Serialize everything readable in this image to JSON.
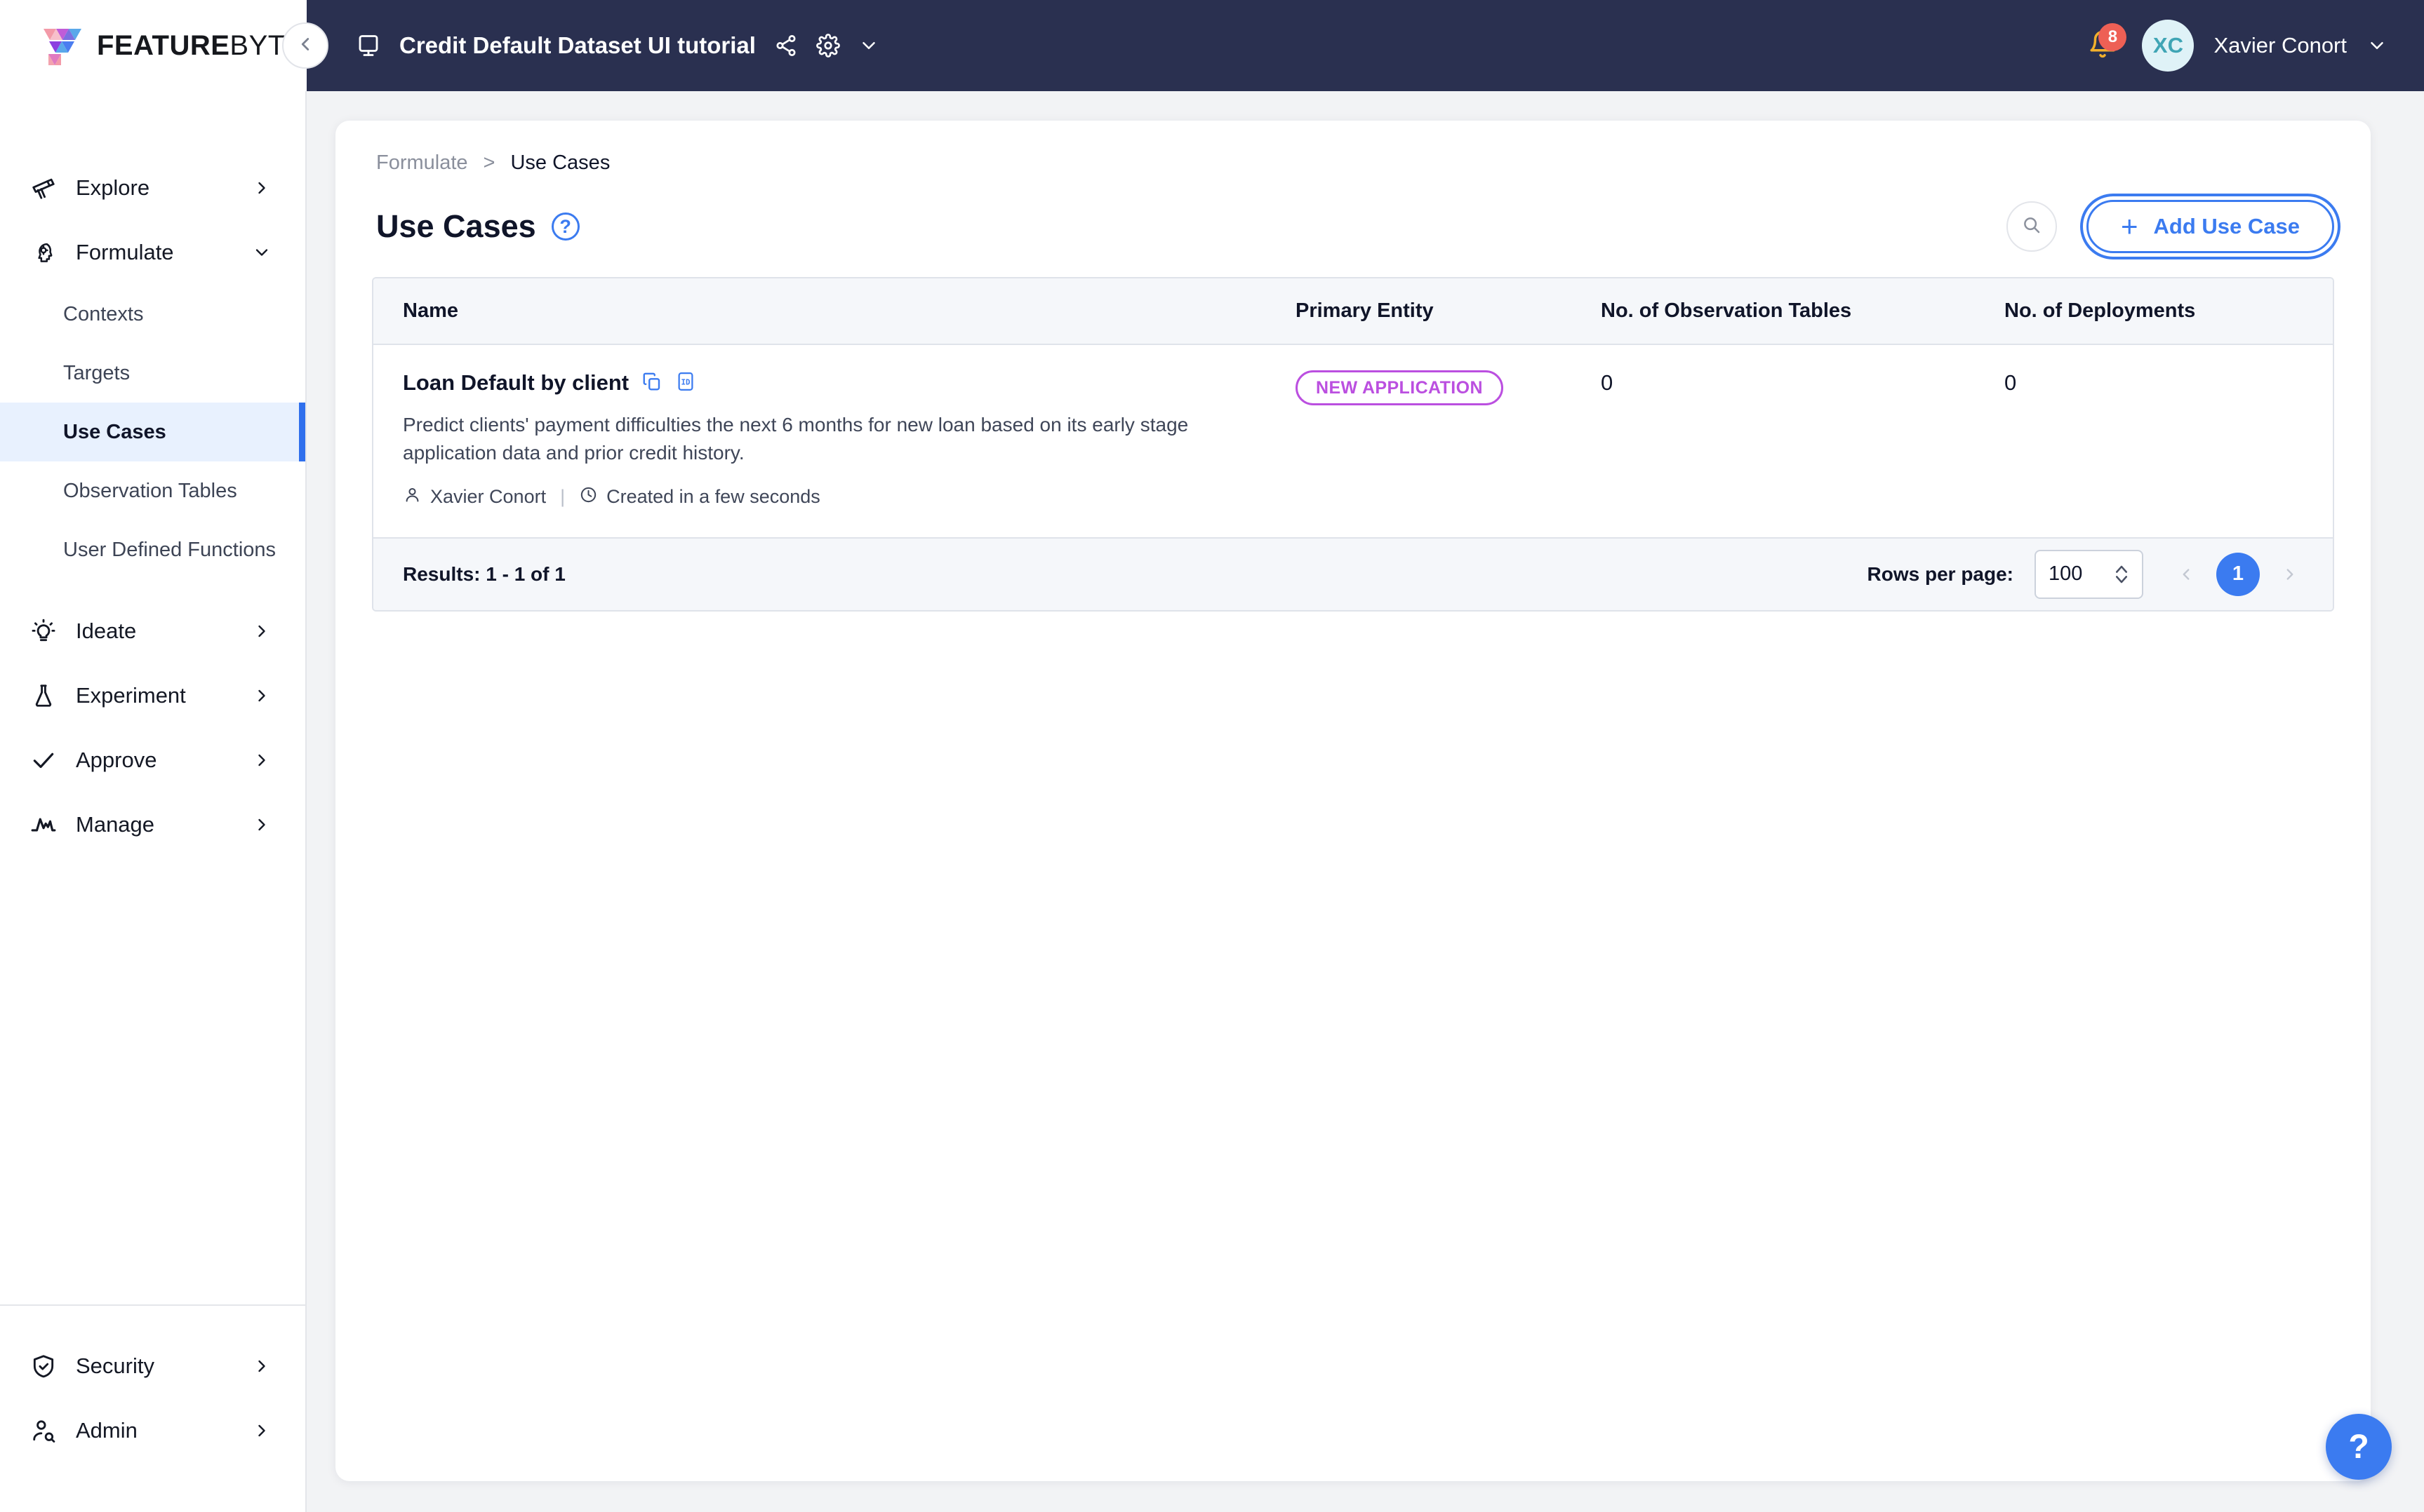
{
  "brand": {
    "name_bold": "FEATURE",
    "name_thin": "BYTE"
  },
  "topbar": {
    "project_title": "Credit Default Dataset UI tutorial",
    "share_icon": "share-icon",
    "settings_icon": "gear-icon",
    "project_chevron_icon": "chevron-down-icon",
    "collapse_icon": "chevron-left-icon",
    "monitor_icon": "monitor-icon",
    "notifications": {
      "icon": "bell-icon",
      "count": "8"
    },
    "user": {
      "initials": "XC",
      "name": "Xavier Conort",
      "chevron_icon": "chevron-down-icon"
    }
  },
  "sidebar": {
    "groups": [
      {
        "label": "Explore",
        "icon": "telescope-icon",
        "chevron": "chevron-right-icon",
        "expanded": false
      },
      {
        "label": "Formulate",
        "icon": "brain-gear-icon",
        "chevron": "chevron-down-icon",
        "expanded": true
      },
      {
        "label": "Ideate",
        "icon": "lightbulb-icon",
        "chevron": "chevron-right-icon",
        "expanded": false
      },
      {
        "label": "Experiment",
        "icon": "flask-icon",
        "chevron": "chevron-right-icon",
        "expanded": false
      },
      {
        "label": "Approve",
        "icon": "check-icon",
        "chevron": "chevron-right-icon",
        "expanded": false
      },
      {
        "label": "Manage",
        "icon": "pulse-icon",
        "chevron": "chevron-right-icon",
        "expanded": false
      }
    ],
    "formulate_children": [
      {
        "label": "Contexts",
        "active": false
      },
      {
        "label": "Targets",
        "active": false
      },
      {
        "label": "Use Cases",
        "active": true
      },
      {
        "label": "Observation Tables",
        "active": false
      },
      {
        "label": "User Defined Functions",
        "active": false
      }
    ],
    "bottom": [
      {
        "label": "Security",
        "icon": "shield-check-icon",
        "chevron": "chevron-right-icon"
      },
      {
        "label": "Admin",
        "icon": "user-search-icon",
        "chevron": "chevron-right-icon"
      }
    ]
  },
  "main": {
    "breadcrumb": {
      "parent": "Formulate",
      "separator": ">",
      "current": "Use Cases"
    },
    "page_title": "Use Cases",
    "help_glyph": "?",
    "search_icon": "search-icon",
    "add_button": {
      "label": "Add Use Case",
      "plus": "+"
    },
    "table": {
      "columns": [
        "Name",
        "Primary Entity",
        "No. of Observation Tables",
        "No. of Deployments"
      ],
      "rows": [
        {
          "name": "Loan Default by client",
          "copy_icon": "copy-icon",
          "id_icon": "id-icon",
          "description": "Predict clients' payment difficulties the next 6 months for new loan based on its early stage application data and prior credit history.",
          "author_icon": "user-icon",
          "author": "Xavier Conort",
          "meta_separator": "|",
          "clock_icon": "clock-icon",
          "created": "Created in a few seconds",
          "primary_entity": "NEW APPLICATION",
          "observation_tables": "0",
          "deployments": "0"
        }
      ]
    },
    "footer": {
      "results": "Results: 1 - 1 of 1",
      "rows_per_page_label": "Rows per page:",
      "rows_per_page_value": "100",
      "prev_icon": "chevron-left-icon",
      "next_icon": "chevron-right-icon",
      "current_page": "1"
    },
    "fab": {
      "glyph": "?",
      "name": "help-icon"
    }
  },
  "colors": {
    "header_navy": "#2a3050",
    "accent_blue": "#3b7bf0",
    "badge_purple": "#bb4fe0",
    "badge_red": "#ee6055",
    "avatar_bg": "#dff2f7",
    "avatar_text": "#3fa5b5",
    "active_nav_bg": "#e8f1fe",
    "table_head_bg": "#f5f7fa",
    "page_bg": "#f2f3f5"
  }
}
